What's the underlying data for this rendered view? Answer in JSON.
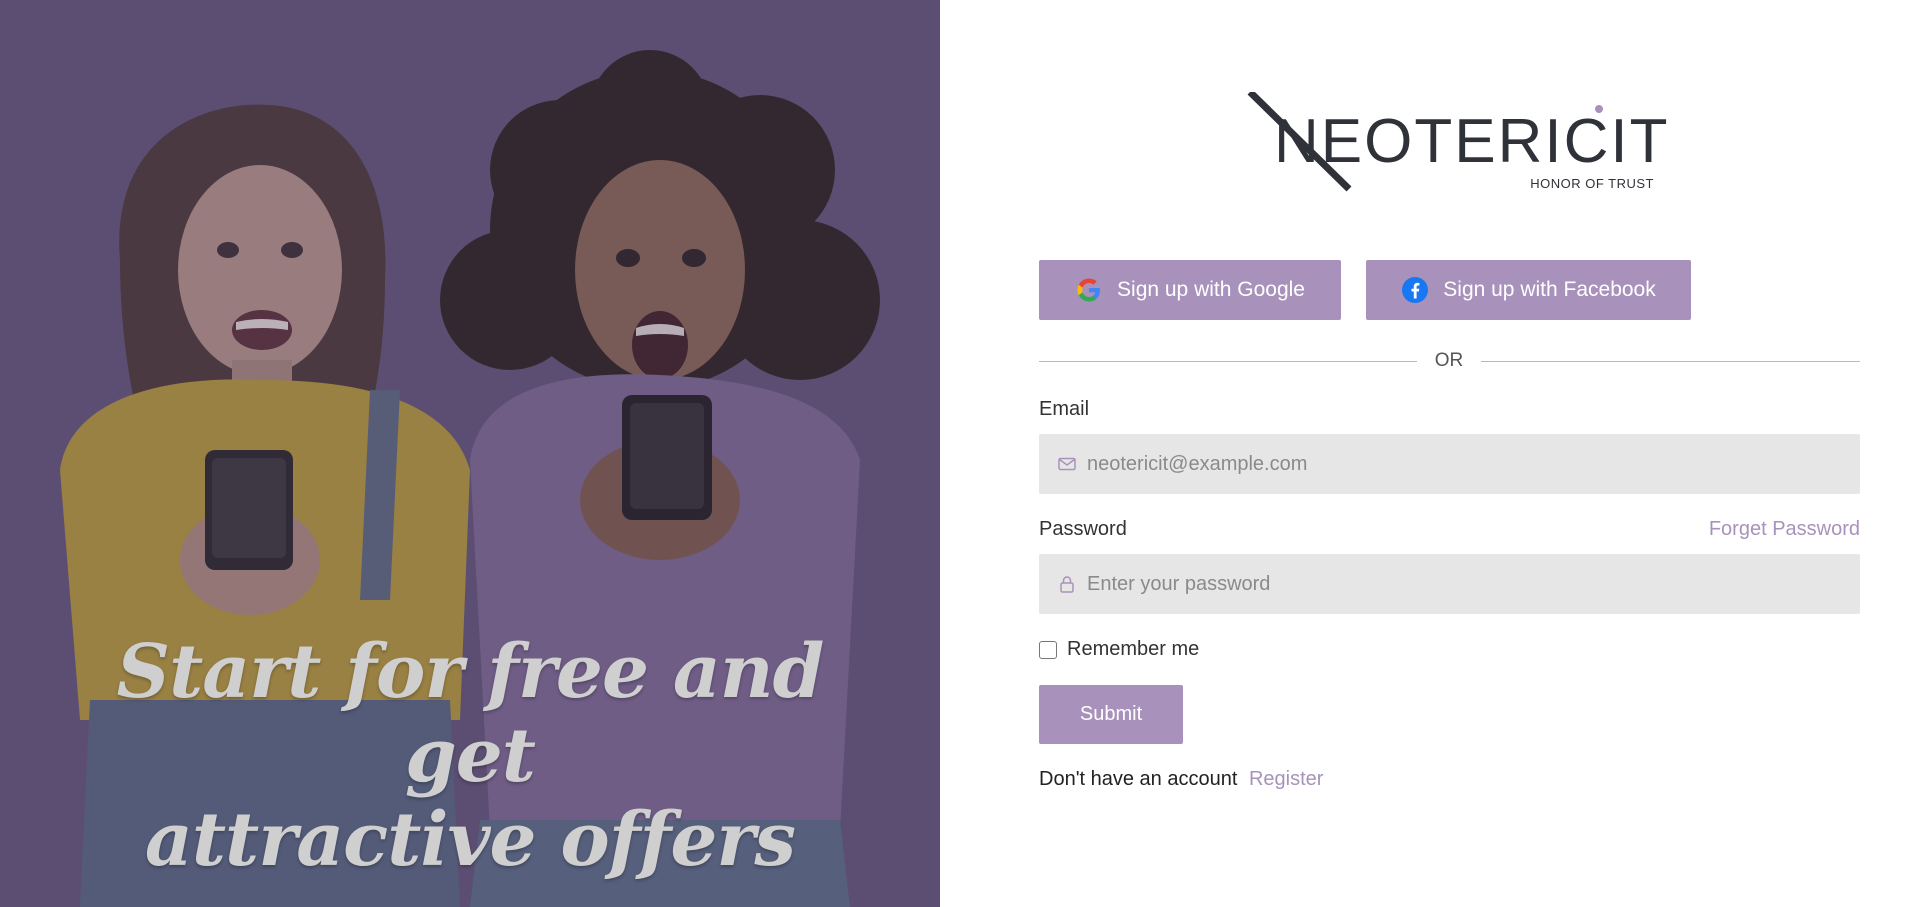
{
  "hero": {
    "headline_line1": "Start for free and get",
    "headline_line2": "attractive offers"
  },
  "logo": {
    "wordmark": "NEOTERICIT",
    "tagline": "HONOR OF TRUST"
  },
  "social": {
    "google_label": "Sign up with Google",
    "facebook_label": "Sign up with Facebook"
  },
  "divider": {
    "text": "OR"
  },
  "form": {
    "email_label": "Email",
    "email_placeholder": "neotericit@example.com",
    "email_value": "",
    "password_label": "Password",
    "forget_password": "Forget Password",
    "password_placeholder": "Enter your password",
    "password_value": "",
    "remember_label": "Remember me",
    "remember_checked": false,
    "submit_label": "Submit",
    "no_account_text": "Don't have an account",
    "register_link": "Register"
  },
  "icons": {
    "google": "google-g-icon",
    "facebook": "facebook-f-icon",
    "email": "envelope-icon",
    "password": "lock-icon"
  },
  "colors": {
    "accent": "#a892bb",
    "input_bg": "#e6e6e6",
    "hero_overlay": "#5e4f73",
    "logo_text": "#2f3238",
    "logo_dot": "#a892bb"
  }
}
